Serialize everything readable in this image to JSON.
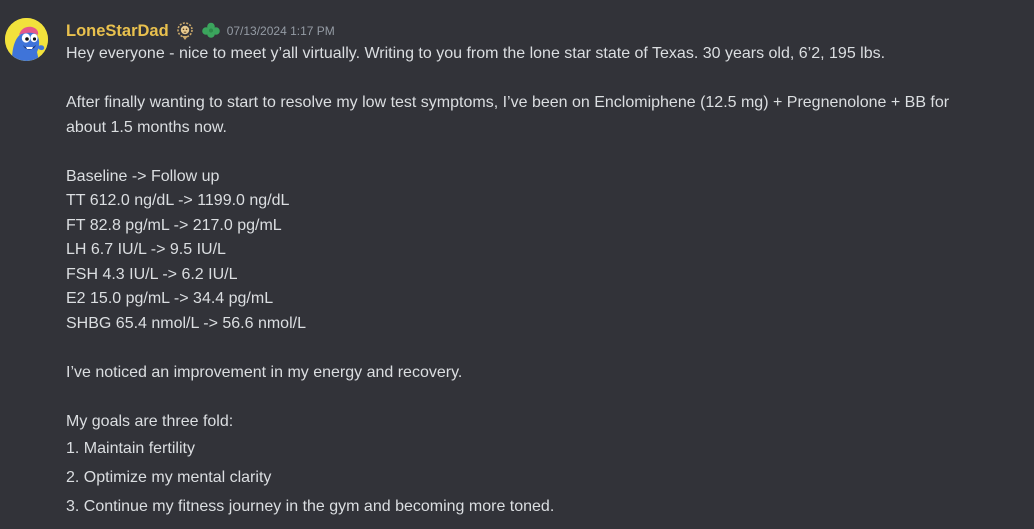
{
  "message": {
    "username": "LoneStarDad",
    "timestamp": "07/13/2024 1:17 PM",
    "badges": [
      "lion-badge-icon",
      "clover-badge-icon"
    ],
    "colors": {
      "background": "#323339",
      "username": "#e9c14e",
      "text": "#dbdee1",
      "timestamp": "#949ba4"
    },
    "intro": "Hey everyone - nice to meet y’all virtually. Writing to you from the lone star state of Texas. 30 years old, 6’2, 195 lbs.",
    "treatment_line1": "After finally wanting to start to resolve my low test symptoms, I’ve been on Enclomiphene (12.5 mg) + Pregnenolone + BB for",
    "treatment_line2": "about 1.5 months now.",
    "labs_header": "Baseline -> Follow up",
    "labs": [
      "TT 612.0 ng/dL -> 1199.0 ng/dL",
      "FT 82.8 pg/mL -> 217.0 pg/mL",
      "LH 6.7 IU/L -> 9.5 IU/L",
      "FSH 4.3 IU/L -> 6.2 IU/L",
      "E2 15.0 pg/mL -> 34.4 pg/mL",
      "SHBG 65.4 nmol/L -> 56.6 nmol/L"
    ],
    "improvement": "I’ve noticed an improvement in my energy and recovery.",
    "goals_header": "My goals are three fold:",
    "goals": [
      "1. Maintain fertility",
      "2. Optimize my mental clarity",
      "3. Continue my fitness journey in the gym and becoming more toned."
    ]
  }
}
